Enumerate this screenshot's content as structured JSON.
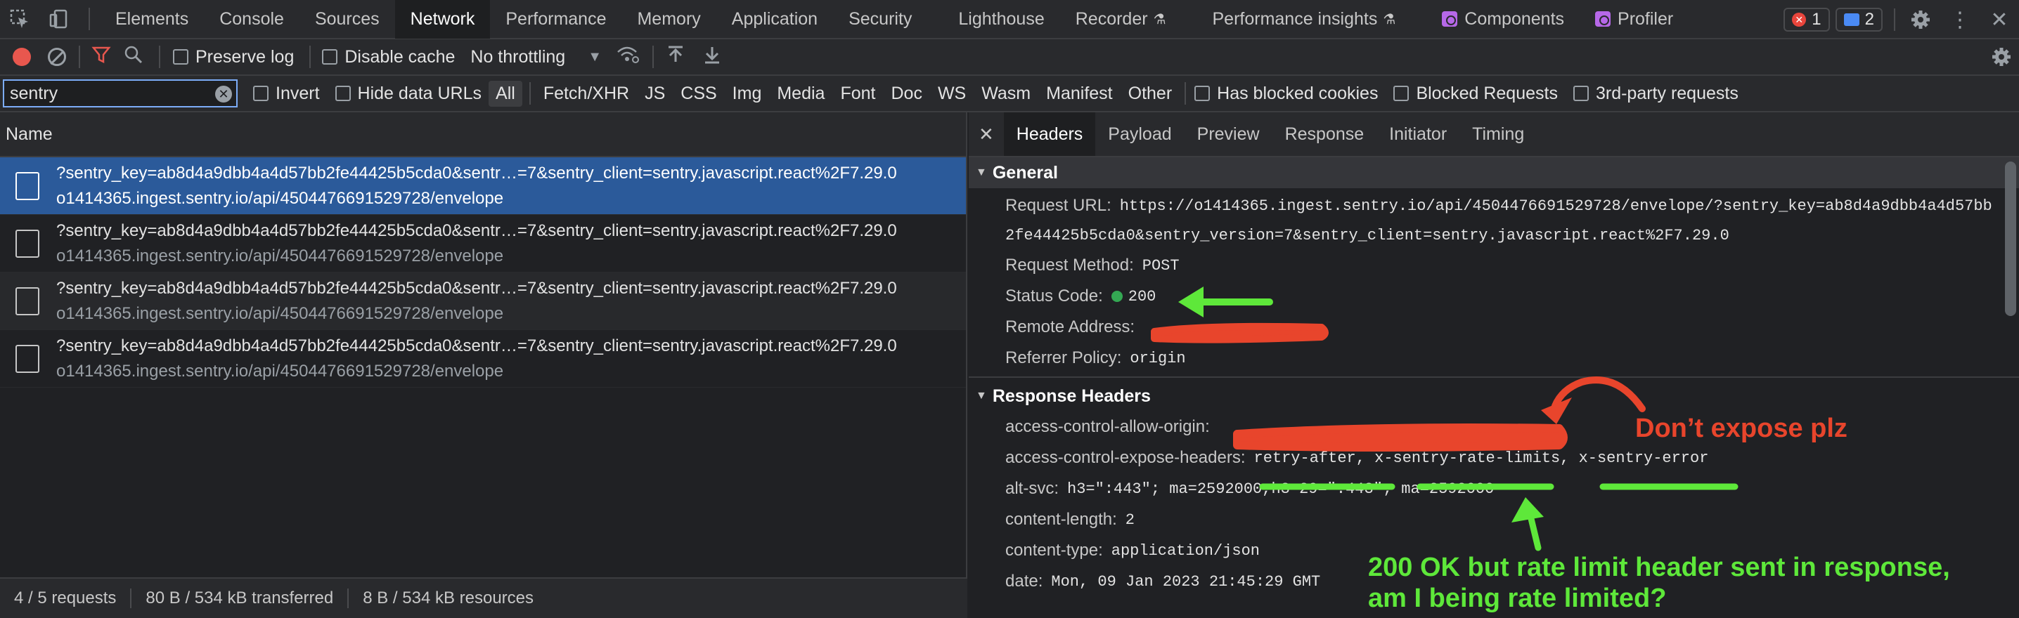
{
  "devtools": {
    "tabs": [
      {
        "label": "Elements"
      },
      {
        "label": "Console"
      },
      {
        "label": "Sources"
      },
      {
        "label": "Network"
      },
      {
        "label": "Performance"
      },
      {
        "label": "Memory"
      },
      {
        "label": "Application"
      },
      {
        "label": "Security"
      },
      {
        "label": "Lighthouse"
      },
      {
        "label": "Recorder"
      },
      {
        "label": "Performance insights"
      },
      {
        "label": "Components"
      },
      {
        "label": "Profiler"
      }
    ],
    "error_count": "1",
    "message_count": "2"
  },
  "toolbar": {
    "preserve_log": "Preserve log",
    "disable_cache": "Disable cache",
    "throttling": "No throttling"
  },
  "filter": {
    "value": "sentry",
    "invert": "Invert",
    "hide_data_urls": "Hide data URLs",
    "types": [
      "All",
      "Fetch/XHR",
      "JS",
      "CSS",
      "Img",
      "Media",
      "Font",
      "Doc",
      "WS",
      "Wasm",
      "Manifest",
      "Other"
    ],
    "has_blocked_cookies": "Has blocked cookies",
    "blocked_requests": "Blocked Requests",
    "third_party": "3rd-party requests"
  },
  "requests": {
    "column": "Name",
    "rows": [
      {
        "line1": "?sentry_key=ab8d4a9dbb4a4d57bb2fe44425b5cda0&sentr…=7&sentry_client=sentry.javascript.react%2F7.29.0",
        "line2": "o1414365.ingest.sentry.io/api/4504476691529728/envelope"
      },
      {
        "line1": "?sentry_key=ab8d4a9dbb4a4d57bb2fe44425b5cda0&sentr…=7&sentry_client=sentry.javascript.react%2F7.29.0",
        "line2": "o1414365.ingest.sentry.io/api/4504476691529728/envelope"
      },
      {
        "line1": "?sentry_key=ab8d4a9dbb4a4d57bb2fe44425b5cda0&sentr…=7&sentry_client=sentry.javascript.react%2F7.29.0",
        "line2": "o1414365.ingest.sentry.io/api/4504476691529728/envelope"
      },
      {
        "line1": "?sentry_key=ab8d4a9dbb4a4d57bb2fe44425b5cda0&sentr…=7&sentry_client=sentry.javascript.react%2F7.29.0",
        "line2": "o1414365.ingest.sentry.io/api/4504476691529728/envelope"
      }
    ],
    "status": {
      "requests": "4 / 5 requests",
      "transferred": "80 B / 534 kB transferred",
      "resources": "8 B / 534 kB resources"
    }
  },
  "details": {
    "tabs": [
      "Headers",
      "Payload",
      "Preview",
      "Response",
      "Initiator",
      "Timing"
    ],
    "general": {
      "title": "General",
      "request_url_label": "Request URL:",
      "request_url_1": "https://o1414365.ingest.sentry.io/api/4504476691529728/envelope/?sentry_key=ab8d4a9dbb4a4d57bb",
      "request_url_2": "2fe44425b5cda0&sentry_version=7&sentry_client=sentry.javascript.react%2F7.29.0",
      "method_label": "Request Method:",
      "method": "POST",
      "status_label": "Status Code:",
      "status": "200",
      "remote_label": "Remote Address:",
      "referrer_label": "Referrer Policy:",
      "referrer": "origin"
    },
    "response": {
      "title": "Response Headers",
      "headers": [
        {
          "k": "access-control-allow-origin:",
          "v": ""
        },
        {
          "k": "access-control-expose-headers:",
          "v": "retry-after, x-sentry-rate-limits, x-sentry-error"
        },
        {
          "k": "alt-svc:",
          "v": "h3=\":443\"; ma=2592000,h3-29=\":443\"; ma=2592000"
        },
        {
          "k": "content-length:",
          "v": "2"
        },
        {
          "k": "content-type:",
          "v": "application/json"
        },
        {
          "k": "date:",
          "v": "Mon, 09 Jan 2023 21:45:29 GMT"
        }
      ]
    }
  },
  "annotations": {
    "red_note": "Don’t expose plz",
    "green_note_1": "200 OK but rate limit header sent in response,",
    "green_note_2": "am I being rate limited?",
    "red_color": "#e8452c",
    "green_color": "#5ee83a"
  }
}
